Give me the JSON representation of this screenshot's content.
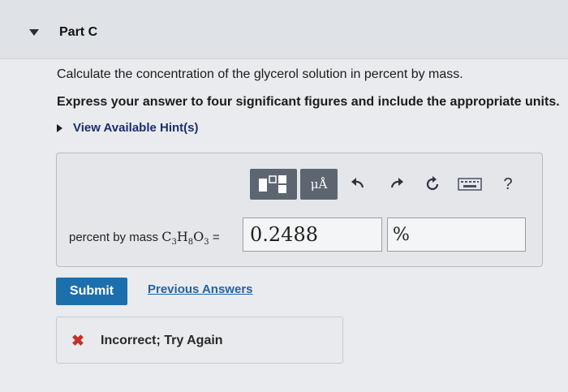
{
  "part": {
    "title": "Part C",
    "expand_icon": "triangle-down-icon"
  },
  "question": {
    "prompt": "Calculate the concentration of the glycerol solution in percent by mass.",
    "instruction": "Express your answer to four significant figures and include the appropriate units."
  },
  "hints": {
    "label": "View Available Hint(s)"
  },
  "toolbar": {
    "units_label": "μÅ",
    "icons": [
      "templates-icon",
      "units-icon",
      "undo-icon",
      "redo-icon",
      "reset-icon",
      "keyboard-icon",
      "help-icon"
    ],
    "help_label": "?"
  },
  "equation": {
    "label_prefix": "percent by mass ",
    "formula": {
      "c": "C",
      "c_sub": "3",
      "h": "H",
      "h_sub": "8",
      "o": "O",
      "o_sub": "3"
    },
    "equals": " ="
  },
  "answer": {
    "value": "0.2488",
    "unit": "%"
  },
  "actions": {
    "submit_label": "Submit",
    "previous_label": "Previous Answers"
  },
  "feedback": {
    "icon": "x-mark-icon",
    "text": "Incorrect; Try Again",
    "color": "#c4302b"
  }
}
